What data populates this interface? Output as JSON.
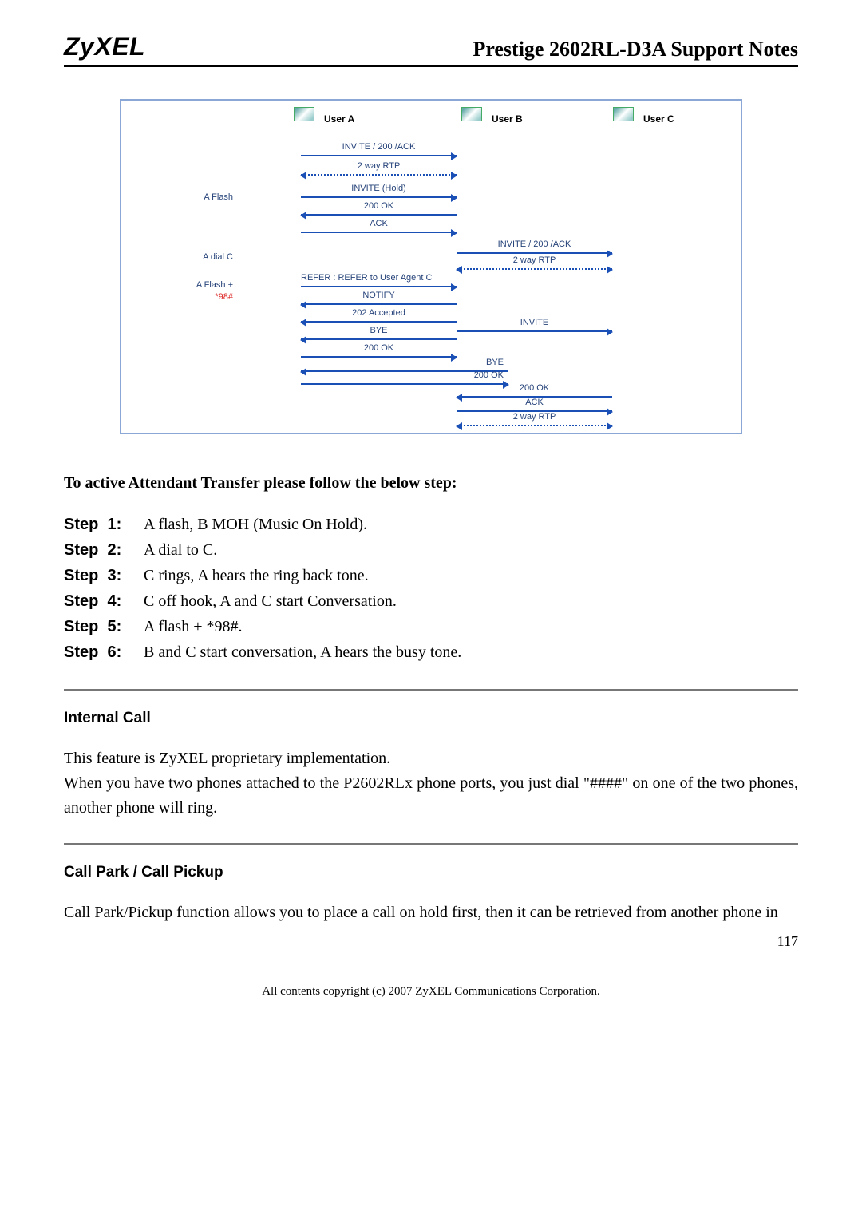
{
  "header": {
    "brand": "ZyXEL",
    "doc_title": "Prestige 2602RL-D3A Support Notes"
  },
  "diagram": {
    "users": {
      "a": "User A",
      "b": "User B",
      "c": "User C"
    },
    "side_labels": {
      "aflash": "A Flash",
      "adialc": "A dial C",
      "aflash98": "A Flash +",
      "aflash98b": "*98#"
    },
    "msgs": {
      "invite200ack": "INVITE / 200 /ACK",
      "twowayrtp": "2 way RTP",
      "invite_hold": "INVITE (Hold)",
      "ok200": "200 OK",
      "ack": "ACK",
      "refer": "REFER : REFER to User Agent C",
      "notify": "NOTIFY",
      "accepted202": "202 Accepted",
      "bye": "BYE",
      "invite": "INVITE"
    }
  },
  "attendant": {
    "heading": "To active Attendant Transfer please follow the below step:",
    "steps": [
      {
        "label": "Step  1:",
        "body": "A flash, B MOH (Music On Hold)."
      },
      {
        "label": "Step  2:",
        "body": "A dial to C."
      },
      {
        "label": "Step  3:",
        "body": "C rings, A hears the ring back tone."
      },
      {
        "label": "Step  4:",
        "body": "C off hook, A and C start Conversation."
      },
      {
        "label": "Step  5:",
        "body": "A flash + *98#."
      },
      {
        "label": "Step  6:",
        "body": "B and C start conversation, A hears the busy tone."
      }
    ]
  },
  "internal_call": {
    "heading": "Internal Call",
    "p1": "This feature is ZyXEL proprietary implementation.",
    "p2": "When you have two phones attached to the P2602RLx phone ports, you just dial \"####\" on one of the two phones, another phone will ring."
  },
  "call_park": {
    "heading": "Call Park / Call Pickup",
    "p1": "Call Park/Pickup function allows you to place a call on hold first, then it can be retrieved from another phone in"
  },
  "footer": {
    "copyright": "All contents copyright (c) 2007 ZyXEL Communications Corporation.",
    "page": "117"
  }
}
